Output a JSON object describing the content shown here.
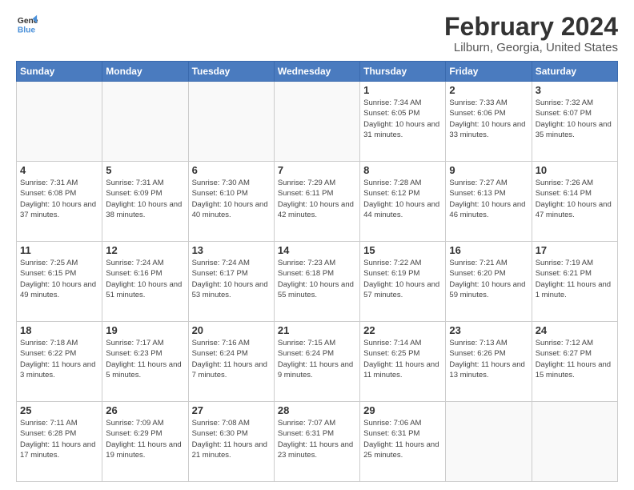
{
  "header": {
    "logo_line1": "General",
    "logo_line2": "Blue",
    "title": "February 2024",
    "subtitle": "Lilburn, Georgia, United States"
  },
  "weekdays": [
    "Sunday",
    "Monday",
    "Tuesday",
    "Wednesday",
    "Thursday",
    "Friday",
    "Saturday"
  ],
  "weeks": [
    [
      {
        "day": "",
        "info": ""
      },
      {
        "day": "",
        "info": ""
      },
      {
        "day": "",
        "info": ""
      },
      {
        "day": "",
        "info": ""
      },
      {
        "day": "1",
        "info": "Sunrise: 7:34 AM\nSunset: 6:05 PM\nDaylight: 10 hours\nand 31 minutes."
      },
      {
        "day": "2",
        "info": "Sunrise: 7:33 AM\nSunset: 6:06 PM\nDaylight: 10 hours\nand 33 minutes."
      },
      {
        "day": "3",
        "info": "Sunrise: 7:32 AM\nSunset: 6:07 PM\nDaylight: 10 hours\nand 35 minutes."
      }
    ],
    [
      {
        "day": "4",
        "info": "Sunrise: 7:31 AM\nSunset: 6:08 PM\nDaylight: 10 hours\nand 37 minutes."
      },
      {
        "day": "5",
        "info": "Sunrise: 7:31 AM\nSunset: 6:09 PM\nDaylight: 10 hours\nand 38 minutes."
      },
      {
        "day": "6",
        "info": "Sunrise: 7:30 AM\nSunset: 6:10 PM\nDaylight: 10 hours\nand 40 minutes."
      },
      {
        "day": "7",
        "info": "Sunrise: 7:29 AM\nSunset: 6:11 PM\nDaylight: 10 hours\nand 42 minutes."
      },
      {
        "day": "8",
        "info": "Sunrise: 7:28 AM\nSunset: 6:12 PM\nDaylight: 10 hours\nand 44 minutes."
      },
      {
        "day": "9",
        "info": "Sunrise: 7:27 AM\nSunset: 6:13 PM\nDaylight: 10 hours\nand 46 minutes."
      },
      {
        "day": "10",
        "info": "Sunrise: 7:26 AM\nSunset: 6:14 PM\nDaylight: 10 hours\nand 47 minutes."
      }
    ],
    [
      {
        "day": "11",
        "info": "Sunrise: 7:25 AM\nSunset: 6:15 PM\nDaylight: 10 hours\nand 49 minutes."
      },
      {
        "day": "12",
        "info": "Sunrise: 7:24 AM\nSunset: 6:16 PM\nDaylight: 10 hours\nand 51 minutes."
      },
      {
        "day": "13",
        "info": "Sunrise: 7:24 AM\nSunset: 6:17 PM\nDaylight: 10 hours\nand 53 minutes."
      },
      {
        "day": "14",
        "info": "Sunrise: 7:23 AM\nSunset: 6:18 PM\nDaylight: 10 hours\nand 55 minutes."
      },
      {
        "day": "15",
        "info": "Sunrise: 7:22 AM\nSunset: 6:19 PM\nDaylight: 10 hours\nand 57 minutes."
      },
      {
        "day": "16",
        "info": "Sunrise: 7:21 AM\nSunset: 6:20 PM\nDaylight: 10 hours\nand 59 minutes."
      },
      {
        "day": "17",
        "info": "Sunrise: 7:19 AM\nSunset: 6:21 PM\nDaylight: 11 hours\nand 1 minute."
      }
    ],
    [
      {
        "day": "18",
        "info": "Sunrise: 7:18 AM\nSunset: 6:22 PM\nDaylight: 11 hours\nand 3 minutes."
      },
      {
        "day": "19",
        "info": "Sunrise: 7:17 AM\nSunset: 6:23 PM\nDaylight: 11 hours\nand 5 minutes."
      },
      {
        "day": "20",
        "info": "Sunrise: 7:16 AM\nSunset: 6:24 PM\nDaylight: 11 hours\nand 7 minutes."
      },
      {
        "day": "21",
        "info": "Sunrise: 7:15 AM\nSunset: 6:24 PM\nDaylight: 11 hours\nand 9 minutes."
      },
      {
        "day": "22",
        "info": "Sunrise: 7:14 AM\nSunset: 6:25 PM\nDaylight: 11 hours\nand 11 minutes."
      },
      {
        "day": "23",
        "info": "Sunrise: 7:13 AM\nSunset: 6:26 PM\nDaylight: 11 hours\nand 13 minutes."
      },
      {
        "day": "24",
        "info": "Sunrise: 7:12 AM\nSunset: 6:27 PM\nDaylight: 11 hours\nand 15 minutes."
      }
    ],
    [
      {
        "day": "25",
        "info": "Sunrise: 7:11 AM\nSunset: 6:28 PM\nDaylight: 11 hours\nand 17 minutes."
      },
      {
        "day": "26",
        "info": "Sunrise: 7:09 AM\nSunset: 6:29 PM\nDaylight: 11 hours\nand 19 minutes."
      },
      {
        "day": "27",
        "info": "Sunrise: 7:08 AM\nSunset: 6:30 PM\nDaylight: 11 hours\nand 21 minutes."
      },
      {
        "day": "28",
        "info": "Sunrise: 7:07 AM\nSunset: 6:31 PM\nDaylight: 11 hours\nand 23 minutes."
      },
      {
        "day": "29",
        "info": "Sunrise: 7:06 AM\nSunset: 6:31 PM\nDaylight: 11 hours\nand 25 minutes."
      },
      {
        "day": "",
        "info": ""
      },
      {
        "day": "",
        "info": ""
      }
    ]
  ]
}
